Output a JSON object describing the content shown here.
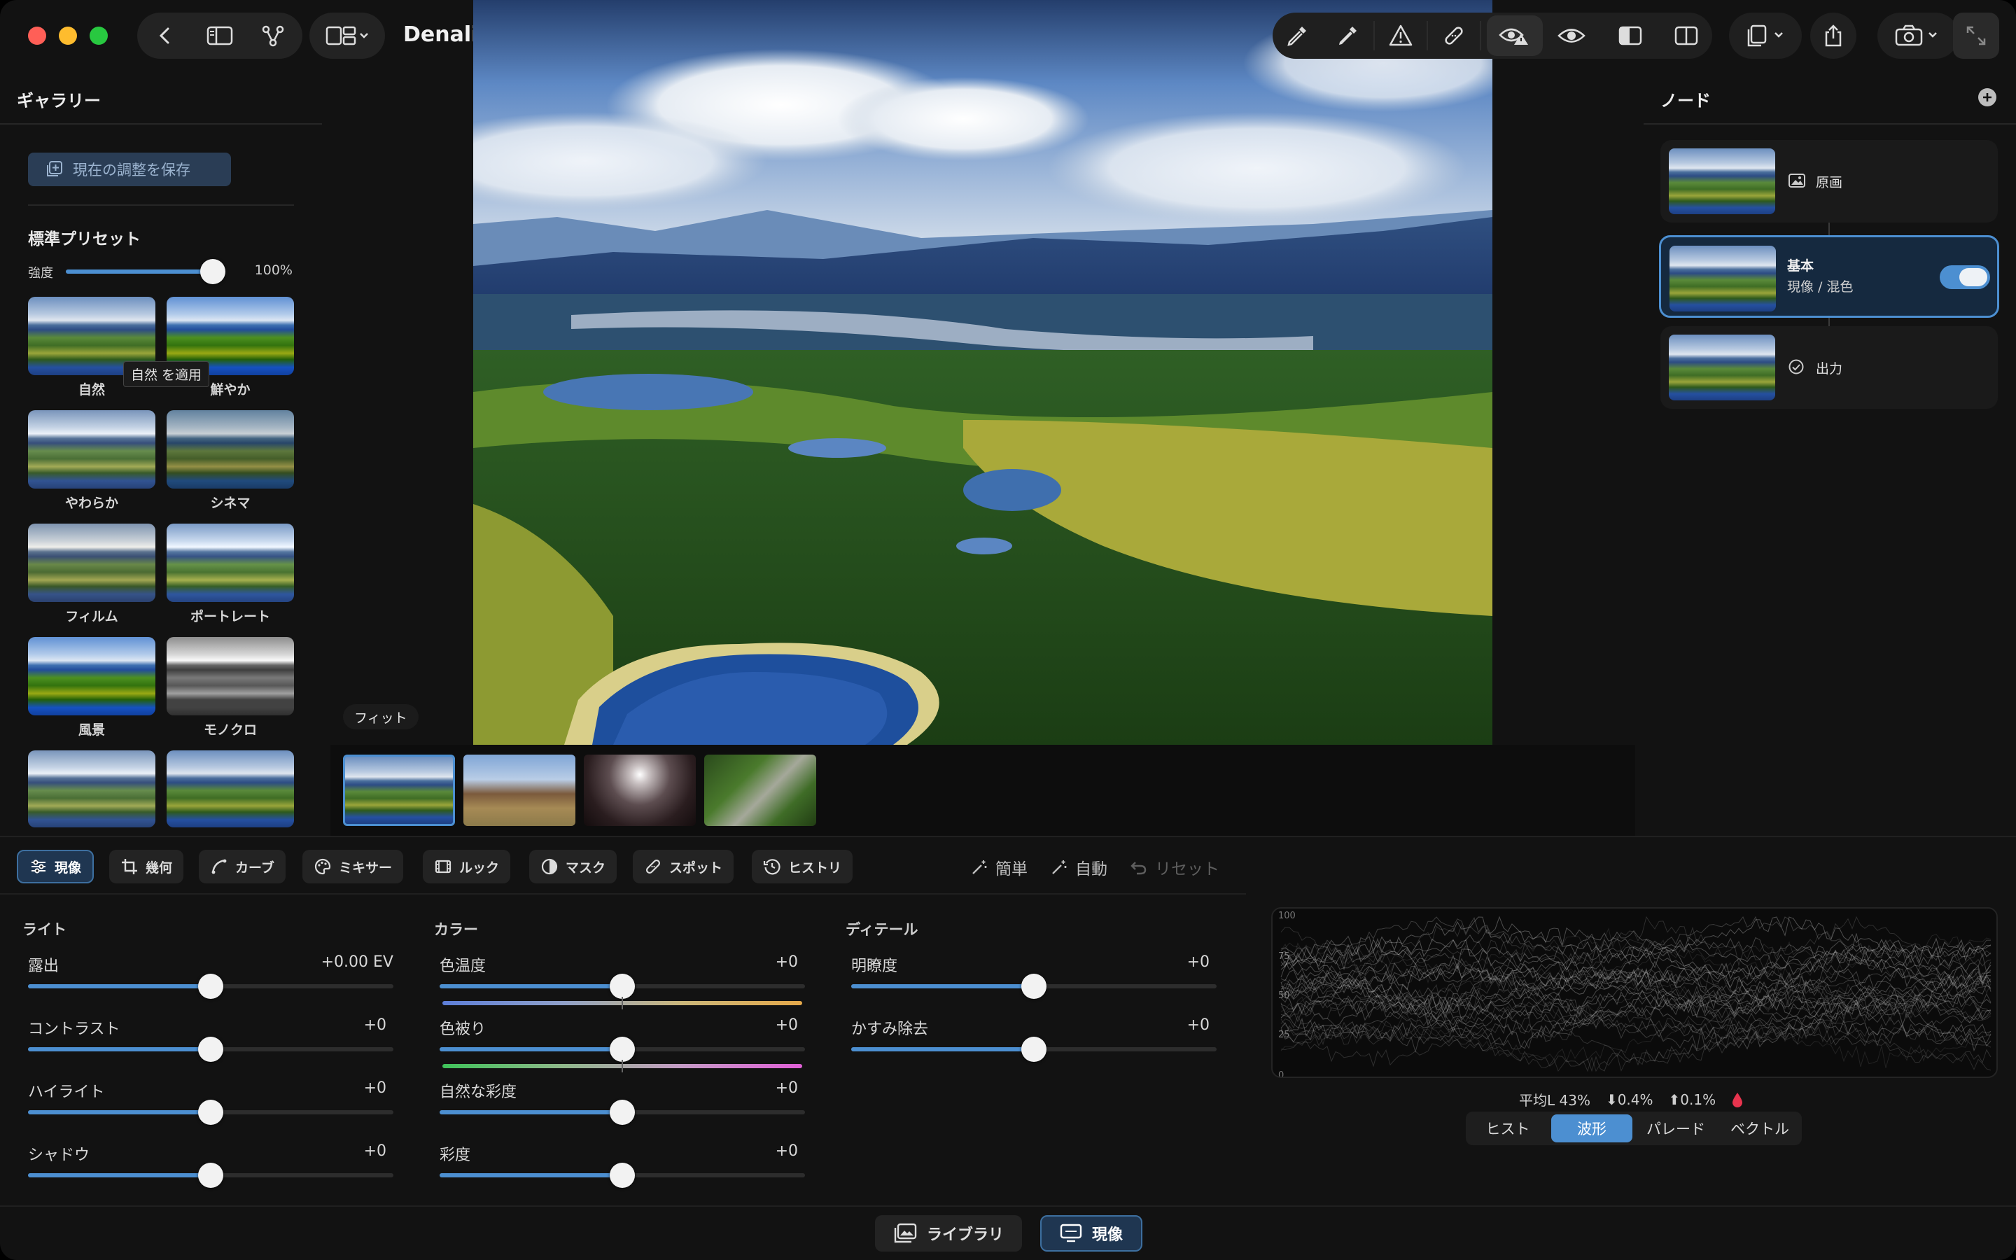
{
  "window": {
    "title": "Denali National Park.jpg"
  },
  "colors": {
    "accent": "#4c8fd1",
    "active_bg": "#1f3651",
    "panel": "#121212"
  },
  "gallery": {
    "title": "ギャラリー",
    "save_button": "現在の調整を保存",
    "presets_title": "標準プリセット",
    "strength_label": "強度",
    "strength_value": "100%",
    "strength_fraction": 1.0,
    "tooltip": "自然 を適用",
    "presets": [
      {
        "label": "自然",
        "style": ""
      },
      {
        "label": "鮮やか",
        "style": "vivid"
      },
      {
        "label": "やわらか",
        "style": "soft"
      },
      {
        "label": "シネマ",
        "style": "cine"
      },
      {
        "label": "フィルム",
        "style": "film"
      },
      {
        "label": "ポートレート",
        "style": "port"
      },
      {
        "label": "風景",
        "style": "vivid"
      },
      {
        "label": "モノクロ",
        "style": "mono"
      },
      {
        "label": "",
        "style": "soft"
      },
      {
        "label": "",
        "style": ""
      }
    ]
  },
  "viewer": {
    "fit_label": "フィット"
  },
  "nodes": {
    "title": "ノード",
    "items": [
      {
        "name": "原画",
        "sub": "",
        "icon": "image-icon"
      },
      {
        "name": "基本",
        "sub": "現像 / 混色",
        "icon": "",
        "enabled": true
      },
      {
        "name": "出力",
        "sub": "",
        "icon": "check-circle-icon"
      }
    ]
  },
  "tabs": [
    {
      "label": "現像",
      "icon": "sliders-icon",
      "active": true
    },
    {
      "label": "幾何",
      "icon": "crop-icon"
    },
    {
      "label": "カーブ",
      "icon": "curve-icon"
    },
    {
      "label": "ミキサー",
      "icon": "palette-icon"
    },
    {
      "label": "ルック",
      "icon": "film-icon"
    },
    {
      "label": "マスク",
      "icon": "mask-icon"
    },
    {
      "label": "スポット",
      "icon": "bandage-icon"
    },
    {
      "label": "ヒストリ",
      "icon": "history-icon"
    }
  ],
  "quick_actions": {
    "simple": "簡単",
    "auto": "自動",
    "reset": "リセット"
  },
  "groups": {
    "light": {
      "title": "ライト",
      "sliders": [
        {
          "label": "露出",
          "value": "+0.00 EV",
          "position": 0.5
        },
        {
          "label": "コントラスト",
          "value": "+0",
          "position": 0.5
        },
        {
          "label": "ハイライト",
          "value": "+0",
          "position": 0.5
        },
        {
          "label": "シャドウ",
          "value": "+0",
          "position": 0.5
        }
      ]
    },
    "color": {
      "title": "カラー",
      "sliders": [
        {
          "label": "色温度",
          "value": "+0",
          "position": 0.5
        },
        {
          "label": "色被り",
          "value": "+0",
          "position": 0.5
        },
        {
          "label": "自然な彩度",
          "value": "+0",
          "position": 0.5
        },
        {
          "label": "彩度",
          "value": "+0",
          "position": 0.5
        }
      ]
    },
    "detail": {
      "title": "ディテール",
      "sliders": [
        {
          "label": "明瞭度",
          "value": "+0",
          "position": 0.5
        },
        {
          "label": "かすみ除去",
          "value": "+0",
          "position": 0.5
        }
      ]
    }
  },
  "scope": {
    "axis": [
      "100",
      "75",
      "50",
      "25",
      "0"
    ],
    "stats": {
      "mean": "平均L 43%",
      "low": "⬇0.4%",
      "high": "⬆0.1%"
    },
    "modes": [
      {
        "label": "ヒスト"
      },
      {
        "label": "波形",
        "active": true
      },
      {
        "label": "パレード"
      },
      {
        "label": "ベクトル"
      }
    ]
  },
  "bottom": {
    "library": "ライブラリ",
    "develop": "現像"
  }
}
